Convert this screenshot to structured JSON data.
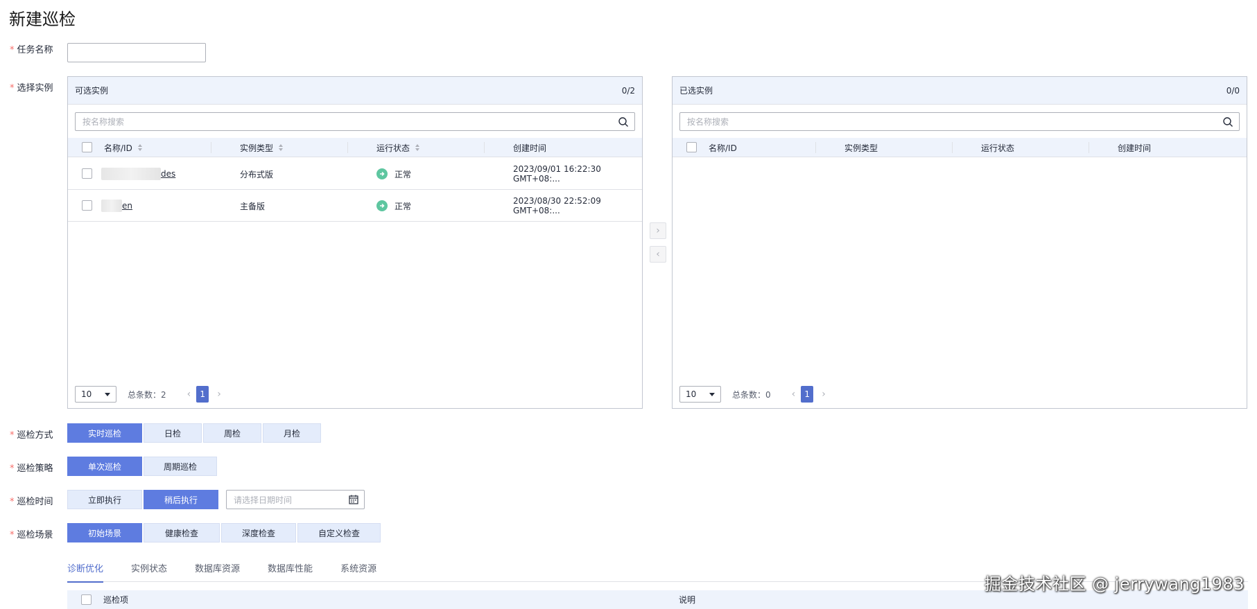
{
  "page": {
    "title": "新建巡检"
  },
  "form": {
    "task_name": {
      "label": "任务名称",
      "value": ""
    },
    "instances": {
      "label": "选择实例"
    },
    "mode": {
      "label": "巡检方式",
      "options": [
        "实时巡检",
        "日检",
        "周检",
        "月检"
      ],
      "selected": "实时巡检"
    },
    "strategy": {
      "label": "巡检策略",
      "options": [
        "单次巡检",
        "周期巡检"
      ],
      "selected": "单次巡检"
    },
    "time": {
      "label": "巡检时间",
      "options": [
        "立即执行",
        "稍后执行"
      ],
      "selected": "稍后执行",
      "date_placeholder": "请选择日期时间"
    },
    "scene": {
      "label": "巡检场景",
      "options": [
        "初始场景",
        "健康检查",
        "深度检查",
        "自定义检查"
      ],
      "selected": "初始场景"
    }
  },
  "available": {
    "title": "可选实例",
    "count": "0/2",
    "search_placeholder": "按名称搜索",
    "columns": [
      "名称/ID",
      "实例类型",
      "运行状态",
      "创建时间"
    ],
    "rows": [
      {
        "name_suffix": "des",
        "type": "分布式版",
        "status": "正常",
        "created": "2023/09/01 16:22:30 GMT+08:..."
      },
      {
        "name_suffix": "en",
        "type": "主备版",
        "status": "正常",
        "created": "2023/08/30 22:52:09 GMT+08:..."
      }
    ],
    "page_size": "10",
    "total": "总条数：2",
    "page": "1"
  },
  "selected": {
    "title": "已选实例",
    "count": "0/0",
    "search_placeholder": "按名称搜索",
    "columns": [
      "名称/ID",
      "实例类型",
      "运行状态",
      "创建时间"
    ],
    "page_size": "10",
    "total": "总条数：0",
    "page": "1"
  },
  "tabs": [
    "诊断优化",
    "实例状态",
    "数据库资源",
    "数据库性能",
    "系统资源"
  ],
  "items_table": {
    "columns": [
      "巡检项",
      "说明"
    ]
  },
  "watermark": "掘金技术社区 @ jerrywang1983",
  "colors": {
    "primary": "#5e7ce0",
    "header_bg": "#eef3fc",
    "required": "#f66f6a",
    "status_ok": "#5ec6a0"
  }
}
